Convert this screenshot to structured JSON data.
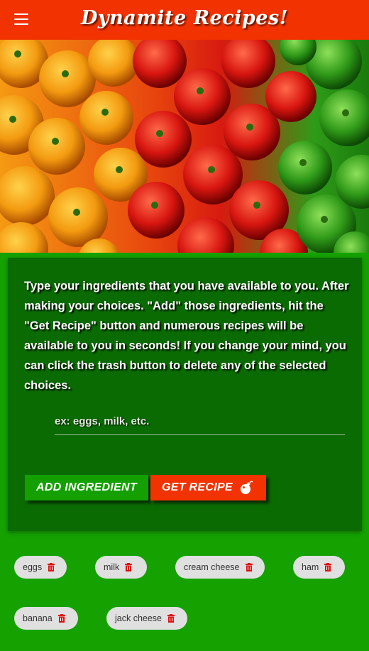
{
  "header": {
    "menu_icon": "hamburger-menu-icon",
    "title": "Dynamite Recipes!"
  },
  "hero": {
    "image": "bell-peppers-photo",
    "colors": [
      "#f59a12",
      "#e8480e",
      "#d81a10",
      "#2e9c18"
    ]
  },
  "card": {
    "intro": "Type your ingredients that you have available to you. After making your choices. \"Add\" those ingredients, hit the \"Get Recipe\" button and numerous recipes will be available to you in seconds! If you change your mind, you can click the trash button to delete any of the selected choices.",
    "input": {
      "placeholder": "ex: eggs, milk, etc.",
      "value": ""
    },
    "add_label": "ADD INGREDIENT",
    "get_label": "GET RECIPE",
    "get_icon": "bomb-icon"
  },
  "chips": [
    {
      "label": "eggs",
      "icon": "trash-icon"
    },
    {
      "label": "milk",
      "icon": "trash-icon"
    },
    {
      "label": "cream cheese",
      "icon": "trash-icon"
    },
    {
      "label": "ham",
      "icon": "trash-icon"
    },
    {
      "label": "banana",
      "icon": "trash-icon"
    },
    {
      "label": "jack cheese",
      "icon": "trash-icon"
    }
  ],
  "colors": {
    "nav": "#f23200",
    "page": "#15a200",
    "card": "#0b6b03",
    "add_button": "#13a000",
    "get_button": "#f23200"
  }
}
